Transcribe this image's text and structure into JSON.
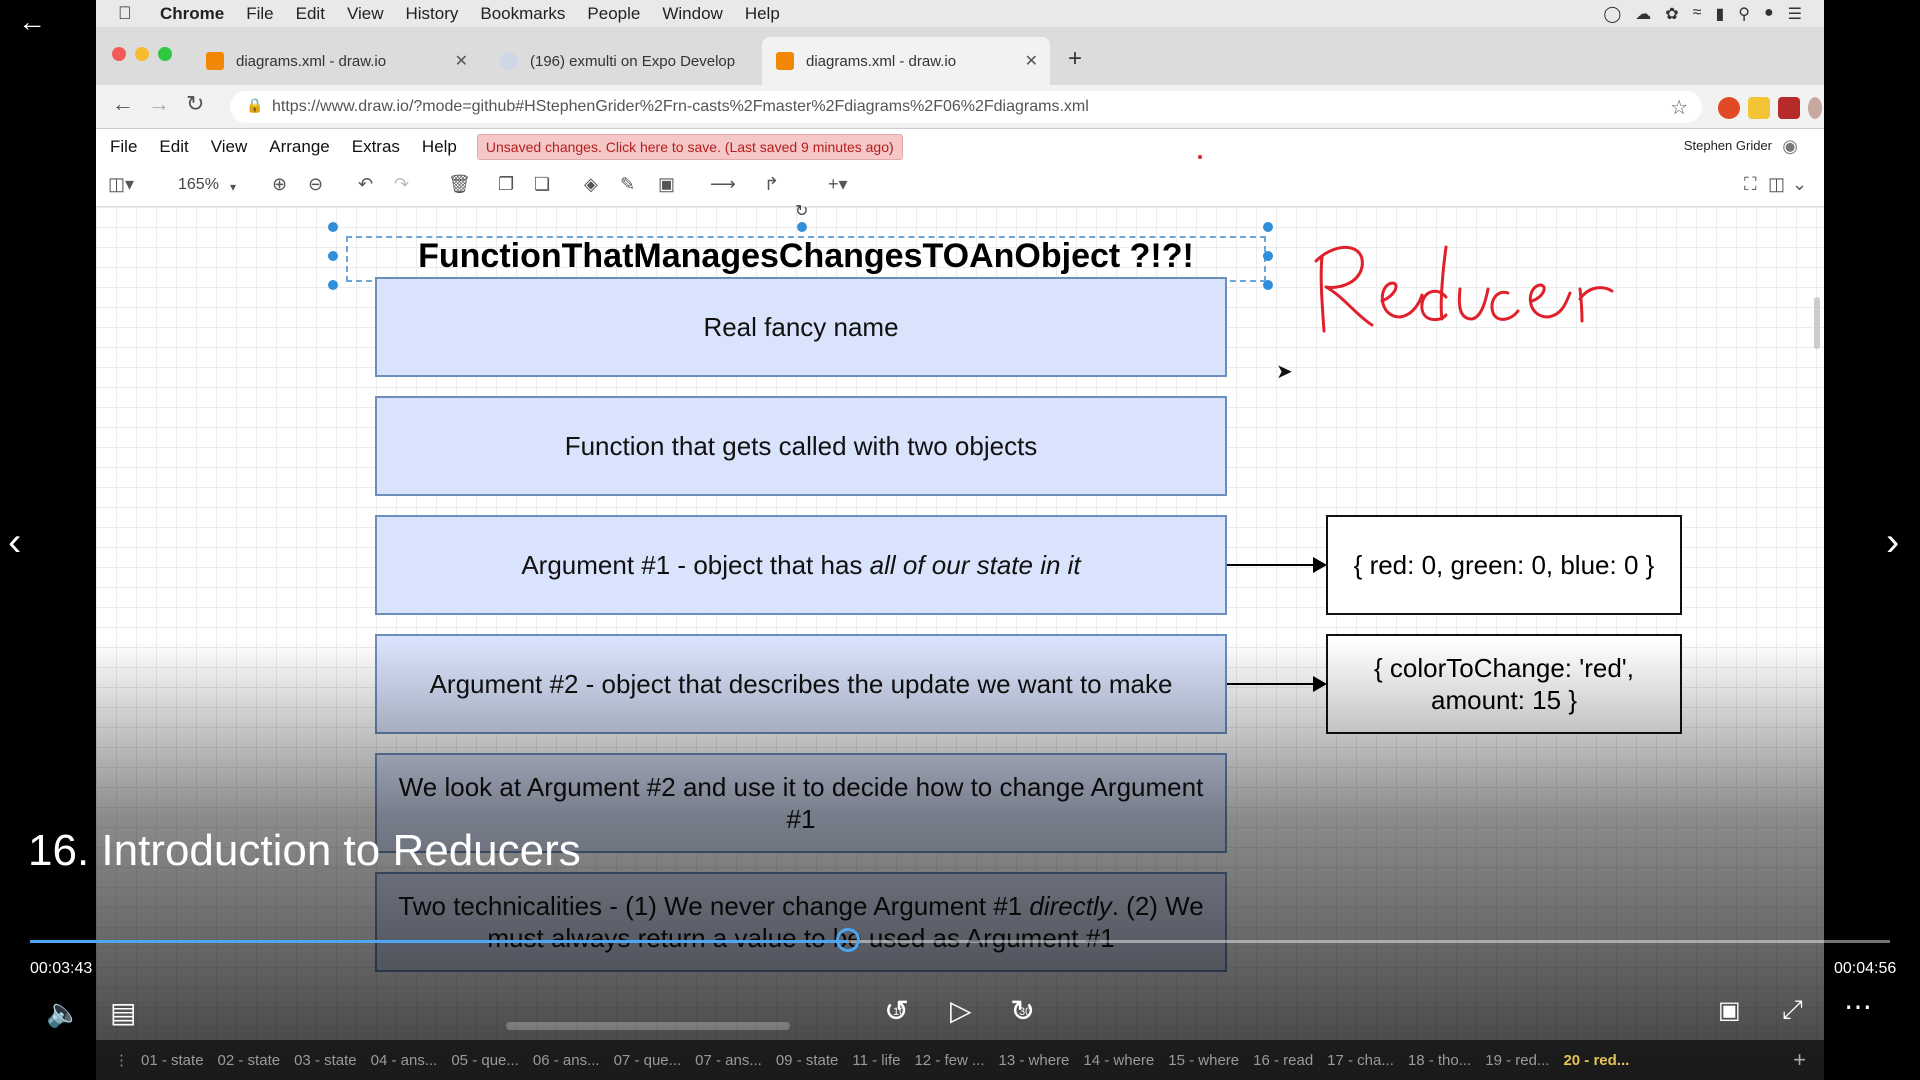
{
  "mac_menu": {
    "app": "Chrome",
    "items": [
      "File",
      "Edit",
      "View",
      "History",
      "Bookmarks",
      "People",
      "Window",
      "Help"
    ]
  },
  "tabs": [
    {
      "title": "diagrams.xml - draw.io",
      "active": false
    },
    {
      "title": "(196) exmulti on Expo Develop",
      "active": false
    },
    {
      "title": "diagrams.xml - draw.io",
      "active": true
    }
  ],
  "address": {
    "url": "https://www.draw.io/?mode=github#HStephenGrider%2Frn-casts%2Fmaster%2Fdiagrams%2F06%2Fdiagrams.xml"
  },
  "drawio_menu": {
    "items": [
      "File",
      "Edit",
      "View",
      "Arrange",
      "Extras",
      "Help"
    ],
    "unsaved_notice": "Unsaved changes. Click here to save. (Last saved 9 minutes ago)",
    "user": "Stephen Grider"
  },
  "toolbar": {
    "zoom": "165%"
  },
  "diagram": {
    "title": "FunctionThatManagesChangesTOAnObject ?!?!",
    "boxes": [
      {
        "text": "Real fancy name"
      },
      {
        "text": "Function that gets called with two objects"
      },
      {
        "text_plain": "Argument #1 - object that has ",
        "text_italic": "all of our state in it"
      },
      {
        "text": "Argument #2 - object that describes the update we want to make"
      },
      {
        "text": "We look at Argument #2 and use it to decide how to change Argument #1"
      },
      {
        "text_plain": "Two technicalities - (1) We never change Argument #1 ",
        "text_italic": "directly",
        "text_rest": ". (2) We must always return a value to be used as Argument #1"
      }
    ],
    "side_boxes": [
      {
        "text": "{ red: 0, green: 0, blue: 0 }"
      },
      {
        "text": "{ colorToChange: 'red', amount: 15 }"
      }
    ],
    "handwriting": "Reducer",
    "handwriting_color": "#e0202a"
  },
  "video": {
    "title": "16. Introduction to Reducers",
    "elapsed": "00:03:43",
    "duration": "00:04:56",
    "progress": 0.44,
    "skip_back_label": "10",
    "skip_forward_label": "30"
  },
  "chapters": [
    "01 - state",
    "02 - state",
    "03 - state",
    "04 - ans...",
    "05 - que...",
    "06 - ans...",
    "07 - que...",
    "07 - ans...",
    "09 - state",
    "11 - life",
    "12 - few ...",
    "13 - where",
    "14 - where",
    "15 - where",
    "16 - read",
    "17 - cha...",
    "18 - tho...",
    "19 - red...",
    "20 - red..."
  ],
  "current_chapter_index": 18
}
